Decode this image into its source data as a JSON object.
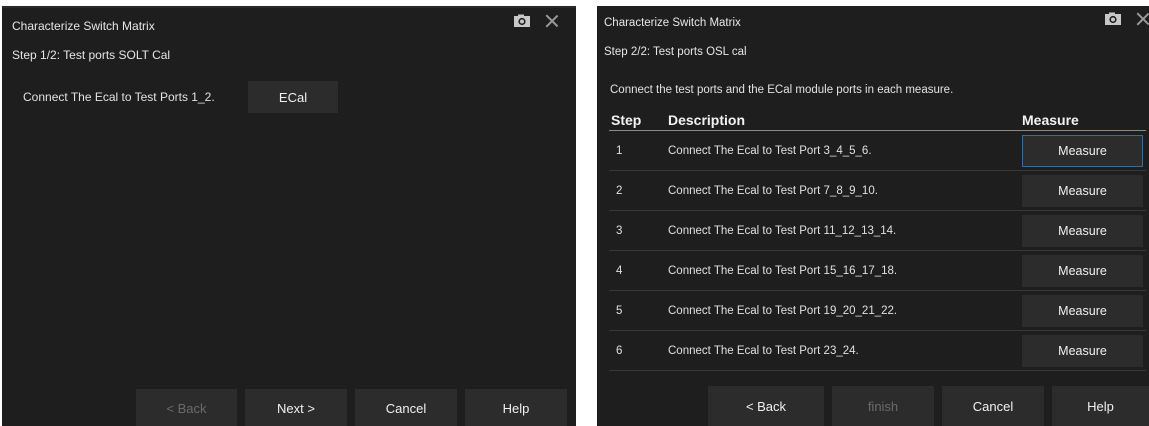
{
  "dialog1": {
    "title": "Characterize Switch Matrix",
    "step": "Step 1/2: Test ports SOLT Cal",
    "connect_text": "Connect The Ecal to Test Ports 1_2.",
    "ecal_label": "ECal",
    "buttons": {
      "back": "< Back",
      "next": "Next >",
      "cancel": "Cancel",
      "help": "Help"
    }
  },
  "dialog2": {
    "title": "Characterize Switch Matrix",
    "step": "Step 2/2: Test ports OSL cal",
    "instruction": "Connect the test ports and the ECal module ports in each measure.",
    "columns": {
      "step": "Step",
      "description": "Description",
      "measure": "Measure"
    },
    "rows": [
      {
        "step": "1",
        "description": "Connect The Ecal to Test Port 3_4_5_6.",
        "button": "Measure"
      },
      {
        "step": "2",
        "description": "Connect The Ecal to Test Port 7_8_9_10.",
        "button": "Measure"
      },
      {
        "step": "3",
        "description": "Connect The Ecal to Test Port 11_12_13_14.",
        "button": "Measure"
      },
      {
        "step": "4",
        "description": "Connect The Ecal to Test Port 15_16_17_18.",
        "button": "Measure"
      },
      {
        "step": "5",
        "description": "Connect The Ecal to Test Port 19_20_21_22.",
        "button": "Measure"
      },
      {
        "step": "6",
        "description": "Connect The Ecal to Test Port 23_24.",
        "button": "Measure"
      }
    ],
    "buttons": {
      "back": "< Back",
      "finish": "finish",
      "cancel": "Cancel",
      "help": "Help"
    }
  },
  "icons": {
    "camera": "camera-icon",
    "close": "close-icon"
  }
}
